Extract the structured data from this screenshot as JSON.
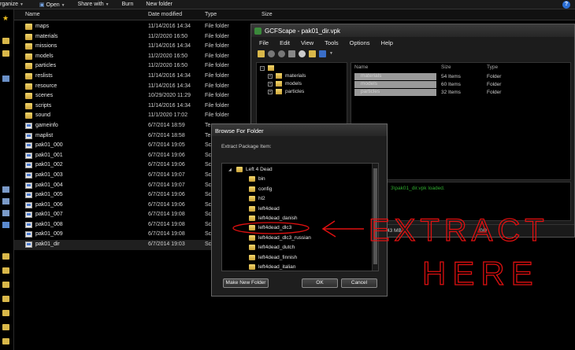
{
  "explorer": {
    "toolbar": {
      "organize": "rganize",
      "open": "Open",
      "share_with": "Share with",
      "burn": "Burn",
      "new_folder": "New folder",
      "help": "?"
    },
    "columns": {
      "name": "Name",
      "date": "Date modified",
      "type": "Type",
      "size": "Size"
    },
    "rows": [
      {
        "name": "maps",
        "date": "11/14/2016 14:34",
        "type": "File folder",
        "kind": "folder"
      },
      {
        "name": "materials",
        "date": "11/2/2020 16:50",
        "type": "File folder",
        "kind": "folder"
      },
      {
        "name": "missions",
        "date": "11/14/2016 14:34",
        "type": "File folder",
        "kind": "folder"
      },
      {
        "name": "models",
        "date": "11/2/2020 16:50",
        "type": "File folder",
        "kind": "folder"
      },
      {
        "name": "particles",
        "date": "11/2/2020 16:50",
        "type": "File folder",
        "kind": "folder"
      },
      {
        "name": "reslists",
        "date": "11/14/2016 14:34",
        "type": "File folder",
        "kind": "folder"
      },
      {
        "name": "resource",
        "date": "11/14/2016 14:34",
        "type": "File folder",
        "kind": "folder"
      },
      {
        "name": "scenes",
        "date": "10/29/2020 11:29",
        "type": "File folder",
        "kind": "folder"
      },
      {
        "name": "scripts",
        "date": "11/14/2016 14:34",
        "type": "File folder",
        "kind": "folder"
      },
      {
        "name": "sound",
        "date": "11/1/2020 17:02",
        "type": "File folder",
        "kind": "folder"
      },
      {
        "name": "gameinfo",
        "date": "6/7/2014 18:59",
        "type": "Te",
        "kind": "file"
      },
      {
        "name": "maplist",
        "date": "6/7/2014 18:58",
        "type": "Te",
        "kind": "file"
      },
      {
        "name": "pak01_000",
        "date": "6/7/2014 19:05",
        "type": "Sc",
        "kind": "file"
      },
      {
        "name": "pak01_001",
        "date": "6/7/2014 19:06",
        "type": "Sc",
        "kind": "file"
      },
      {
        "name": "pak01_002",
        "date": "6/7/2014 19:06",
        "type": "Sc",
        "kind": "file"
      },
      {
        "name": "pak01_003",
        "date": "6/7/2014 19:07",
        "type": "Sc",
        "kind": "file"
      },
      {
        "name": "pak01_004",
        "date": "6/7/2014 19:07",
        "type": "Sc",
        "kind": "file"
      },
      {
        "name": "pak01_005",
        "date": "6/7/2014 19:06",
        "type": "Sc",
        "kind": "file"
      },
      {
        "name": "pak01_006",
        "date": "6/7/2014 19:06",
        "type": "Sc",
        "kind": "file"
      },
      {
        "name": "pak01_007",
        "date": "6/7/2014 19:08",
        "type": "Sc",
        "kind": "file"
      },
      {
        "name": "pak01_008",
        "date": "6/7/2014 19:08",
        "type": "Sc",
        "kind": "file"
      },
      {
        "name": "pak01_009",
        "date": "6/7/2014 19:08",
        "type": "Sc",
        "kind": "file"
      },
      {
        "name": "pak01_dir",
        "date": "6/7/2014 19:03",
        "type": "Sc",
        "kind": "file"
      }
    ]
  },
  "gcfscape": {
    "title": "GCFScape - pak01_dir.vpk",
    "menu": [
      "File",
      "Edit",
      "View",
      "Tools",
      "Options",
      "Help"
    ],
    "tree": [
      "materials",
      "models",
      "particles"
    ],
    "list_headers": {
      "name": "Name",
      "size": "Size",
      "type": "Type"
    },
    "list": [
      {
        "name": "materials",
        "size": "54 Items",
        "type": "Folder"
      },
      {
        "name": "models",
        "size": "60 Items",
        "type": "Folder"
      },
      {
        "name": "particles",
        "size": "32 Items",
        "type": "Folder"
      }
    ],
    "log_message": "3\\pak01_dir.vpk loaded.",
    "status_size": "43 MB",
    "status_count": "0/0"
  },
  "browse_dialog": {
    "title": "Browse For Folder",
    "subtitle": "Extract Package Item:",
    "items": [
      {
        "label": "Left 4 Dead",
        "level": 0,
        "expanded": true
      },
      {
        "label": "bin",
        "level": 1
      },
      {
        "label": "config",
        "level": 1
      },
      {
        "label": "hl2",
        "level": 1
      },
      {
        "label": "left4dead",
        "level": 1
      },
      {
        "label": "left4dead_danish",
        "level": 1
      },
      {
        "label": "left4dead_dlc3",
        "level": 1,
        "circled": true
      },
      {
        "label": "left4dead_dlc3_russian",
        "level": 1
      },
      {
        "label": "left4dead_dutch",
        "level": 1
      },
      {
        "label": "left4dead_finnish",
        "level": 1
      },
      {
        "label": "left4dead_italian",
        "level": 1
      }
    ],
    "buttons": {
      "new_folder": "Make New Folder",
      "ok": "OK",
      "cancel": "Cancel"
    }
  },
  "annotation": {
    "line1": "EXTRACT",
    "line2": "HERE",
    "color": "#e01010"
  }
}
